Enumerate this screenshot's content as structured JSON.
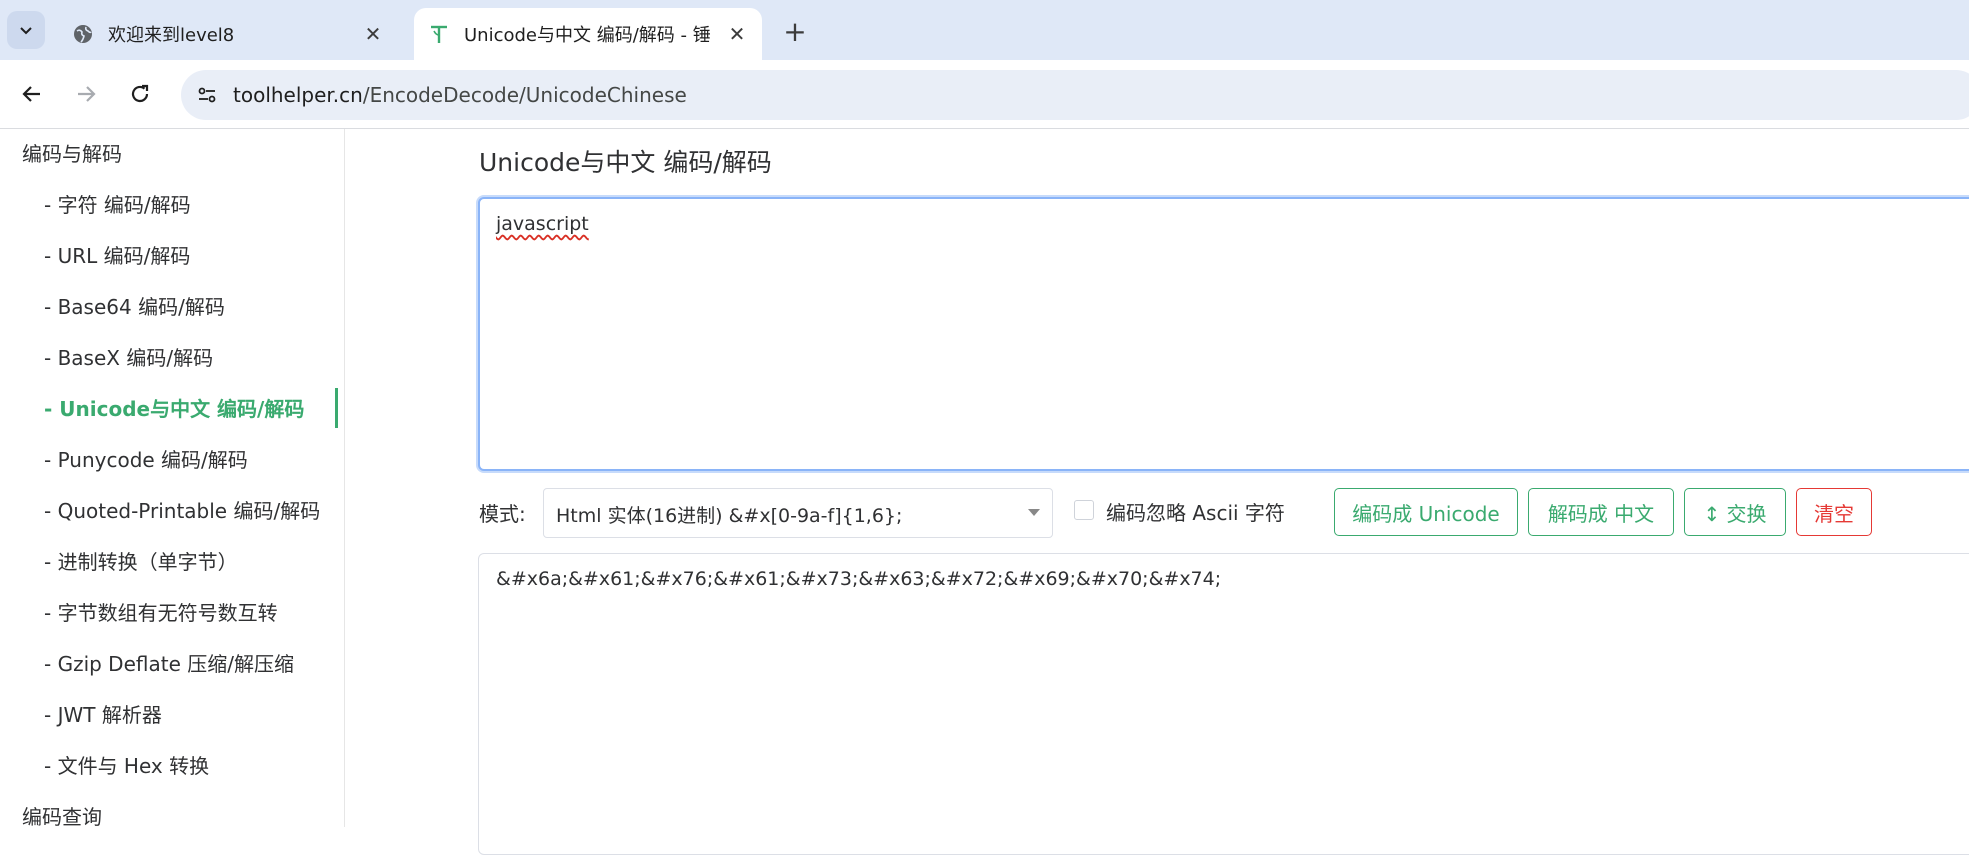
{
  "browser": {
    "tabs": [
      {
        "title": "欢迎来到level8",
        "active": false,
        "icon": "globe-icon"
      },
      {
        "title": "Unicode与中文 编码/解码 - 锤",
        "active": true,
        "icon": "toolhelper-logo-icon"
      }
    ],
    "address": {
      "host": "toolhelper.cn",
      "path": "/EncodeDecode/UnicodeChinese"
    }
  },
  "sidebar": {
    "group_encode": "编码与解码",
    "items": [
      {
        "label": "- 字符  编码/解码"
      },
      {
        "label": "- URL  编码/解码"
      },
      {
        "label": "- Base64  编码/解码"
      },
      {
        "label": "- BaseX  编码/解码"
      },
      {
        "label": "- Unicode与中文  编码/解码"
      },
      {
        "label": "- Punycode  编码/解码"
      },
      {
        "label": "- Quoted-Printable  编码/解码"
      },
      {
        "label": "- 进制转换（单字节）"
      },
      {
        "label": "- 字节数组有无符号数互转"
      },
      {
        "label": "- Gzip Deflate 压缩/解压缩"
      },
      {
        "label": "- JWT 解析器"
      },
      {
        "label": "- 文件与 Hex 转换"
      }
    ],
    "active_index": 4,
    "group_query": "编码查询"
  },
  "main": {
    "title": "Unicode与中文 编码/解码",
    "input_value": "javascript",
    "mode_label": "模式:",
    "mode_value": "Html 实体(16进制) &#x[0-9a-f]{1,6};",
    "ignore_ascii_label": "编码忽略 Ascii 字符",
    "buttons": {
      "encode": "编码成 Unicode",
      "decode": "解码成 中文",
      "swap": "↕ 交换",
      "clear": "清空"
    },
    "output_value": "&#x6a;&#x61;&#x76;&#x61;&#x73;&#x63;&#x72;&#x69;&#x70;&#x74;"
  },
  "colors": {
    "accent": "#3aaa6f",
    "danger": "#e53935",
    "tabstrip": "#dfe8f7"
  }
}
